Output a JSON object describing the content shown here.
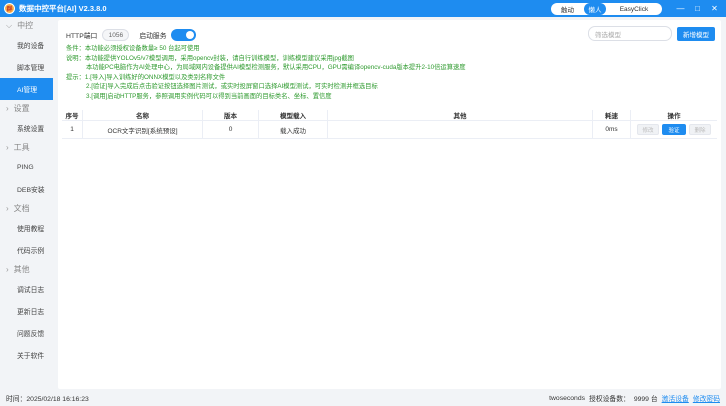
{
  "titlebar": {
    "logo_glyph": "群",
    "title": "数据中控平台[AI] V2.3.8.0",
    "modes": [
      "触动",
      "懒人",
      "EasyClick"
    ],
    "active_mode": "懒人",
    "window_buttons": [
      "—",
      "□",
      "✕"
    ]
  },
  "sidebar": {
    "groups": [
      {
        "label": "中控",
        "items": [
          "我的设备",
          "脚本管理",
          "AI管理"
        ]
      },
      {
        "label": "设置",
        "items": [
          "系统设置"
        ]
      },
      {
        "label": "工具",
        "items": [
          "PING",
          "DEB安装"
        ]
      },
      {
        "label": "文档",
        "items": [
          "使用教程",
          "代码示例"
        ]
      },
      {
        "label": "其他",
        "items": [
          "调试日志",
          "更新日志",
          "问题反馈",
          "关于软件"
        ]
      }
    ],
    "active_item": "AI管理"
  },
  "toolbar": {
    "http_port_label": "HTTP端口",
    "http_port_value": "1056",
    "service_label": "启动服务",
    "service_on": true,
    "filter_placeholder": "筛选模型",
    "new_model_label": "新增模型"
  },
  "notes": {
    "condition": "条件：本功能必须授权设备数量≥ 50 台起可使用",
    "desc1": "说明：本功能提供YOLOv5/v7模型调用，采用opencv封装，请自行训练模型，训练模型建议采用jpg截图",
    "desc2": "本功能PC电脑作为AI处理中心，为局域网内设备提供AI模型检测服务，默认采用CPU，GPU需编译opencv-cuda版本提升2-10倍运算速度",
    "tip1": "提示：1.[导入]导入训练好的ONNX模型以及类别名称文件",
    "tip2": "2.[验证]导入完成后点击验证按钮选择图片测试，或实时投屏窗口选择AI模型测试，可实时检测并框选目标",
    "tip3": "3.[调用]启动HTTP服务，参照调用实例代码可以得到当前画面的目标类名、坐标、置信度"
  },
  "table": {
    "headers": [
      "序号",
      "名称",
      "版本",
      "模型载入",
      "其他",
      "耗速",
      "操作"
    ],
    "rows": [
      {
        "index": "1",
        "name": "OCR文字识别[系统预设]",
        "version": "0",
        "status": "载入成功",
        "other": "",
        "speed": "0ms",
        "actions": [
          "修改",
          "验证",
          "删除"
        ]
      }
    ]
  },
  "statusbar": {
    "time": "时间：2025/02/18 16:16:23",
    "user": "twoseconds",
    "license_label": "授权设备数：",
    "license_count": "9999 台",
    "activate_link": "激活设备",
    "change_password_link": "修改密码"
  },
  "colors": {
    "accent": "#1e8cf0",
    "note_green": "#2e9a2e"
  }
}
